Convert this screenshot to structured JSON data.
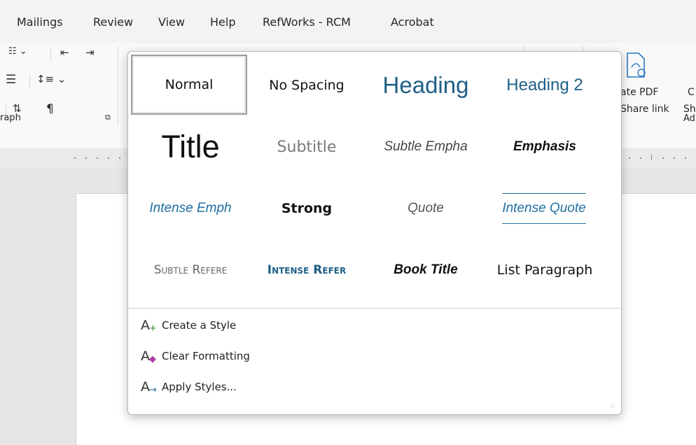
{
  "menu_tabs": [
    "Mailings",
    "Review",
    "View",
    "Help",
    "RefWorks - RCM",
    "Acrobat"
  ],
  "ribbon": {
    "paragraph_group_label": "raph",
    "adobe_group_label": "Ad",
    "create_pdf_line1": "ate PDF",
    "create_pdf_line2": "Share link",
    "share_line1": "C",
    "share_line2": "Sh",
    "icons": [
      "multilevel-list-icon",
      "decrease-indent-icon",
      "increase-indent-icon",
      "align-justify-icon",
      "line-spacing-icon",
      "sort-icon",
      "show-formatting-icon",
      "dialog-launcher-icon",
      "create-pdf-share-link-icon"
    ]
  },
  "styles_gallery": {
    "styles": [
      {
        "label": "Normal",
        "selected": true
      },
      {
        "label": "No Spacing"
      },
      {
        "label": "Heading"
      },
      {
        "label": "Heading 2"
      },
      {
        "label": "Title"
      },
      {
        "label": "Subtitle"
      },
      {
        "label": "Subtle Empha"
      },
      {
        "label": "Emphasis"
      },
      {
        "label": "Intense Emph"
      },
      {
        "label": "Strong"
      },
      {
        "label": "Quote"
      },
      {
        "label": "Intense Quote"
      },
      {
        "label": "Subtle Refere"
      },
      {
        "label": "Intense Refer"
      },
      {
        "label": "Book Title"
      },
      {
        "label": "List Paragraph"
      }
    ],
    "commands": [
      {
        "label": "Create a Style",
        "icon": "create-style-icon"
      },
      {
        "label": "Clear Formatting",
        "icon": "clear-formatting-icon"
      },
      {
        "label": "Apply Styles...",
        "icon": "apply-styles-icon"
      }
    ]
  },
  "colors": {
    "heading_blue": "#1f5f86",
    "intense_blue": "#1f6fa3",
    "subtle_gray": "#7a7a7a"
  }
}
